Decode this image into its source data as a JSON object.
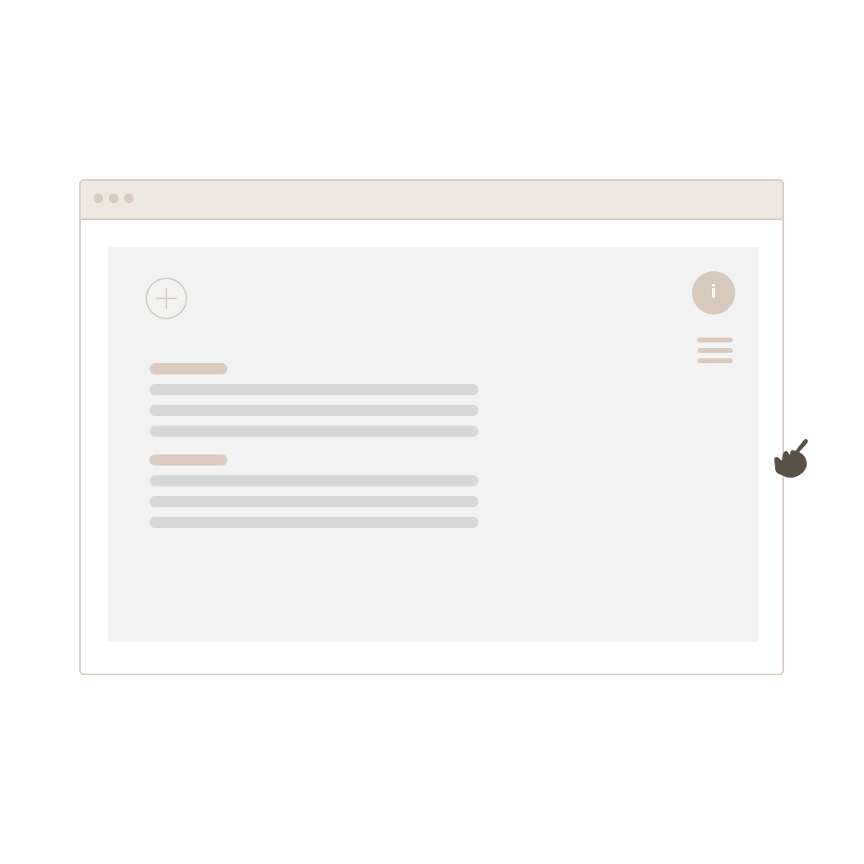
{
  "window": {
    "controls": [
      "dot",
      "dot",
      "dot"
    ]
  },
  "toolbar": {
    "add_icon": "plus-circle-icon",
    "info_label": "i",
    "info_icon": "info-icon",
    "menu_icon": "hamburger-menu-icon"
  },
  "content": {
    "groups": [
      {
        "heading_placeholder": "",
        "line_count": 3
      },
      {
        "heading_placeholder": "",
        "line_count": 3
      }
    ]
  },
  "cursor": {
    "icon": "pointing-hand-cursor-icon"
  },
  "colors": {
    "window_border": "#d8cdc2",
    "titlebar": "#efe8e1",
    "window_dots": "#d9cabd",
    "viewport": "#f2f2f2",
    "accent_beige": "#d7c9bb",
    "text_placeholder": "#d8d8d8",
    "cursor": "#5a5246"
  }
}
